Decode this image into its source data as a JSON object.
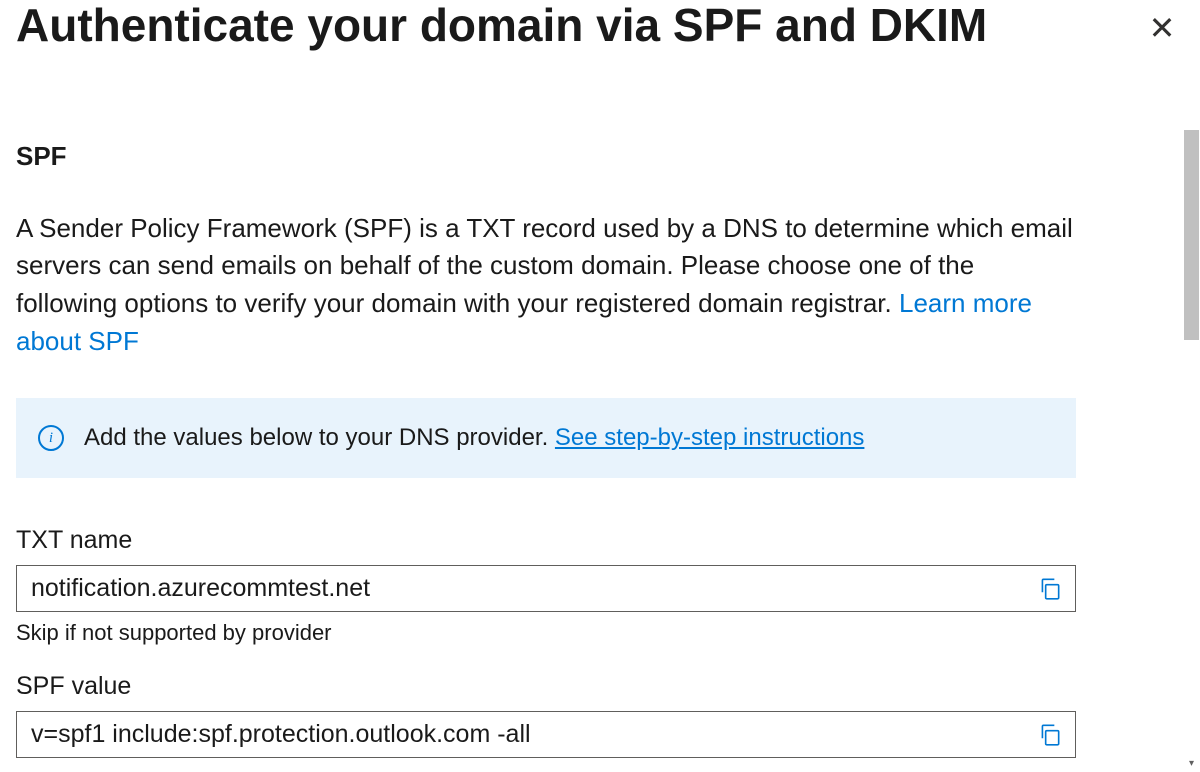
{
  "header": {
    "title": "Authenticate your domain via SPF and DKIM"
  },
  "spf": {
    "section_title": "SPF",
    "description_part1": "A Sender Policy Framework (SPF) is a TXT record used by a DNS to determine which email servers can send emails on behalf of the custom domain. Please choose one of the following options to verify your domain with your registered domain registrar. ",
    "learn_more_label": "Learn more about SPF",
    "info_text": "Add the values below to your DNS provider.  ",
    "info_link": "See step-by-step instructions",
    "txt_name_label": "TXT name",
    "txt_name_value": "notification.azurecommtest.net",
    "txt_name_helper": "Skip if not supported by provider",
    "spf_value_label": "SPF value",
    "spf_value": "v=spf1 include:spf.protection.outlook.com -all"
  }
}
